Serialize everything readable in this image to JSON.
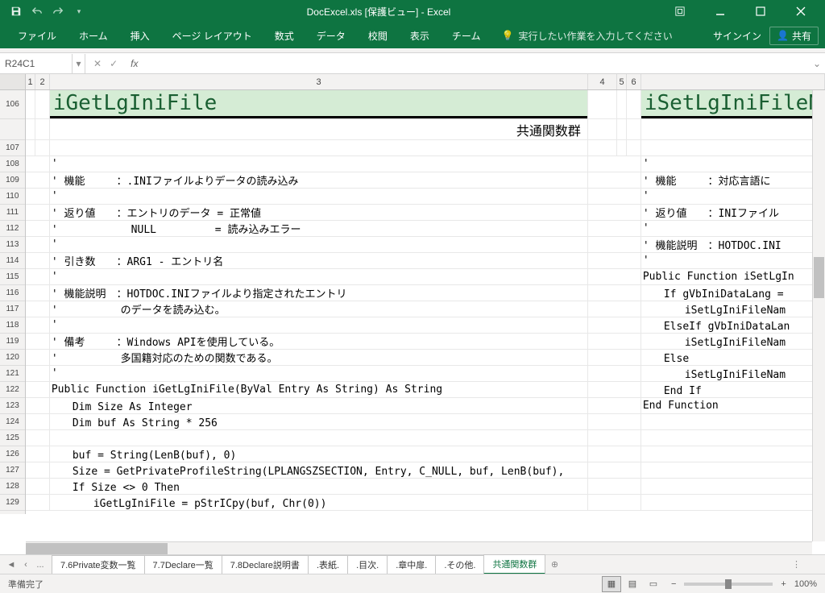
{
  "title": "DocExcel.xls [保護ビュー] - Excel",
  "ribbon": {
    "tabs": [
      "ファイル",
      "ホーム",
      "挿入",
      "ページ レイアウト",
      "数式",
      "データ",
      "校閲",
      "表示",
      "チーム"
    ],
    "tell_me": "実行したい作業を入力してください",
    "signin": "サインイン",
    "share": "共有"
  },
  "nameBox": "R24C1",
  "formula": "",
  "colHeaders": {
    "c1": "1",
    "c2": "2",
    "c3": "3",
    "c4": "4",
    "c5": "5",
    "c6": "6"
  },
  "rows": [
    "106",
    "",
    "107",
    "108",
    "109",
    "110",
    "111",
    "112",
    "113",
    "114",
    "115",
    "116",
    "117",
    "118",
    "119",
    "120",
    "121",
    "122",
    "123",
    "124",
    "125",
    "126",
    "127",
    "128",
    "129"
  ],
  "left": {
    "title": "iGetLgIniFile",
    "subtitle": "共通関数群",
    "lines": {
      "r108": "'",
      "r109": "' 機能　　　：.INIファイルよりデータの読み込み",
      "r110": "'",
      "r111": "' 返り値　　：エントリのデータ = 正常値",
      "r112": "'　　　　　　　NULL　　　　　 = 読み込みエラー",
      "r113": "'",
      "r114": "' 引き数　　：ARG1 - エントリ名",
      "r115": "'",
      "r116": "' 機能説明　：HOTDOC.INIファイルより指定されたエントリ",
      "r117": "'　　　　　　のデータを読み込む。",
      "r118": "'",
      "r119": "' 備考　　　：Windows APIを使用している。",
      "r120": "'　　　　　　多国籍対応のための関数である。",
      "r121": "'",
      "r122": "Public Function iGetLgIniFile(ByVal Entry As String) As String",
      "r123": "　　Dim Size As Integer",
      "r124": "　　Dim buf As String * 256",
      "r125": "",
      "r126": "　　buf = String(LenB(buf), 0)",
      "r127": "　　Size = GetPrivateProfileString(LPLANGSZSECTION, Entry, C_NULL, buf, LenB(buf),",
      "r128": "　　If Size <> 0 Then",
      "r129": "　　　　iGetLgIniFile = pStrICpy(buf, Chr(0))"
    }
  },
  "right": {
    "title": "iSetLgIniFileN",
    "lines": {
      "r108": "'",
      "r109": "' 機能　　　：対応言語に",
      "r110": "'",
      "r111": "' 返り値　　：INIファイル",
      "r112": "'",
      "r113": "' 機能説明　：HOTDOC.INI",
      "r114": "'",
      "r115": "Public Function iSetLgIn",
      "r116": "　　If gVbIniDataLang =",
      "r117": "　　　　iSetLgIniFileNam",
      "r118": "　　ElseIf gVbIniDataLan",
      "r119": "　　　　iSetLgIniFileNam",
      "r120": "　　Else",
      "r121": "　　　　iSetLgIniFileNam",
      "r122": "　　End If",
      "r123": "End Function"
    }
  },
  "sheets": {
    "dots": "...",
    "tabs": [
      "7.6Private変数一覧",
      "7.7Declare一覧",
      "7.8Declare説明書",
      ".表紙.",
      ".目次.",
      ".章中扉.",
      ".その他."
    ],
    "active": "共通関数群"
  },
  "status": {
    "ready": "準備完了",
    "zoom": "100%"
  }
}
